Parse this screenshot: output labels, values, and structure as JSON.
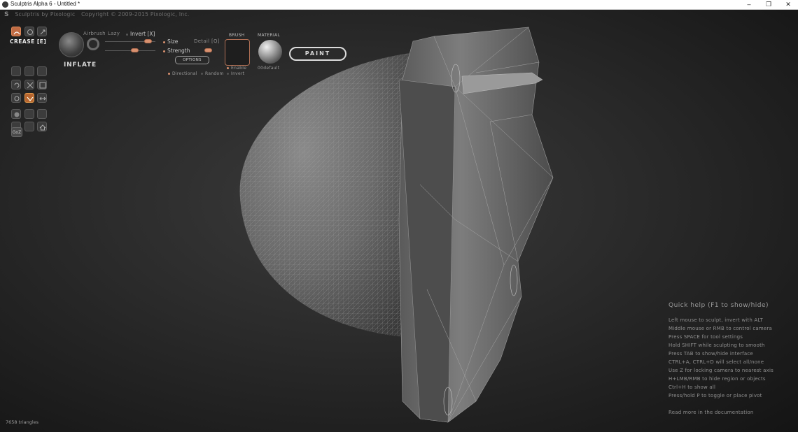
{
  "window": {
    "title": "Sculptris Alpha 6 - Untitled *",
    "controls": [
      "–",
      "❐",
      "✕"
    ]
  },
  "brand": {
    "logo": "S",
    "name": "Sculptris by Pixologic",
    "copyright": "Copyright © 2009-2015 Pixologic, Inc."
  },
  "toolbar": {
    "current_tool_label": "CREASE [E]",
    "brush_name": "INFLATE",
    "airbrush_label": "Airbrush",
    "lazy_label": "Lazy",
    "invert_label": "Invert [X]",
    "size_label": "Size",
    "detail_label": "Detail [Q]",
    "strength_label": "Strength",
    "options_label": "OPTIONS",
    "directional_label": "Directional",
    "random_label": "Random",
    "invert_small_label": "Invert",
    "brush_section_label": "BRUSH",
    "enable_label": "Enable",
    "material_section_label": "MATERIAL",
    "material_name": "00default",
    "paint_label": "PAINT",
    "goz_label": "GoZ"
  },
  "help": {
    "title": "Quick help (F1 to show/hide)",
    "lines": [
      "Left mouse to sculpt, invert with ALT",
      "Middle mouse or RMB to control camera",
      "Press SPACE for tool settings",
      "Hold SHIFT while sculpting to smooth",
      "Press TAB to show/hide interface",
      "CTRL+A, CTRL+D will select all/none",
      "Use Z for locking camera to nearest axis",
      "H+LMB/RMB to hide region or objects",
      "Ctrl+H to show all",
      "Press/hold P to toggle or place pivot"
    ],
    "more": "Read more in the documentation"
  },
  "status": {
    "triangles": "7658 triangles"
  },
  "colors": {
    "accent": "#c06b43",
    "background": "#2a2a2a"
  }
}
